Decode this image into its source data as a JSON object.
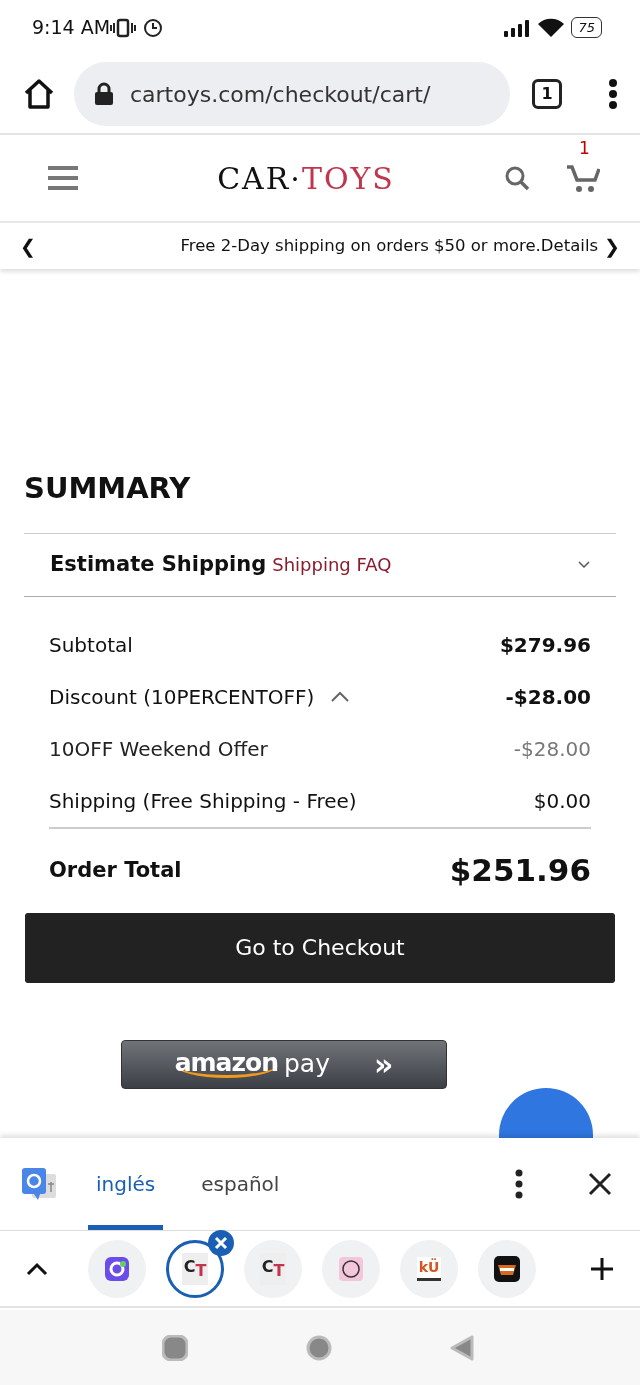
{
  "status_bar": {
    "time": "9:14 AM",
    "battery": "75"
  },
  "browser": {
    "url": "cartoys.com/checkout/cart/",
    "tab_count": "1"
  },
  "header": {
    "logo_left": "CAR",
    "logo_dot": "·",
    "logo_right": "TOYS",
    "cart_count": "1"
  },
  "banner": {
    "prev": "❮",
    "text": "Free 2-Day shipping on orders $50 or more.Details",
    "next": "❯"
  },
  "summary": {
    "title": "SUMMARY",
    "estimate": {
      "label": "Estimate Shipping",
      "link": "Shipping FAQ",
      "expanded": false
    },
    "rows": [
      {
        "kind": "normal",
        "label": "Subtotal",
        "value": "$279.96",
        "bold": true
      },
      {
        "kind": "toggle",
        "label": "Discount (10PERCENTOFF)",
        "value": "-$28.00",
        "bold": true,
        "expanded": true
      },
      {
        "kind": "detail",
        "label": "10OFF Weekend Offer",
        "value": "-$28.00",
        "bold": false
      },
      {
        "kind": "normal",
        "label": "Shipping (Free Shipping - Free)",
        "value": "$0.00",
        "bold": false
      }
    ],
    "total_label": "Order Total",
    "total_value": "$251.96",
    "checkout": "Go to Checkout"
  },
  "amazon_pay": {
    "brand": "amazon",
    "suffix": "pay",
    "arrows": "»"
  },
  "translate_bar": {
    "languages": [
      {
        "label": "inglés",
        "selected": true
      },
      {
        "label": "español",
        "selected": false
      }
    ]
  },
  "tab_strip": {
    "tabs": [
      {
        "kind": "app",
        "selected": false
      },
      {
        "kind": "letters",
        "letters": [
          "C",
          "T"
        ],
        "selected": true
      },
      {
        "kind": "letters",
        "letters": [
          "C",
          "T"
        ],
        "selected": false
      },
      {
        "kind": "round",
        "selected": false
      },
      {
        "kind": "letters2",
        "letters": [
          "kÜ"
        ],
        "selected": false
      },
      {
        "kind": "badge",
        "selected": false
      }
    ]
  }
}
